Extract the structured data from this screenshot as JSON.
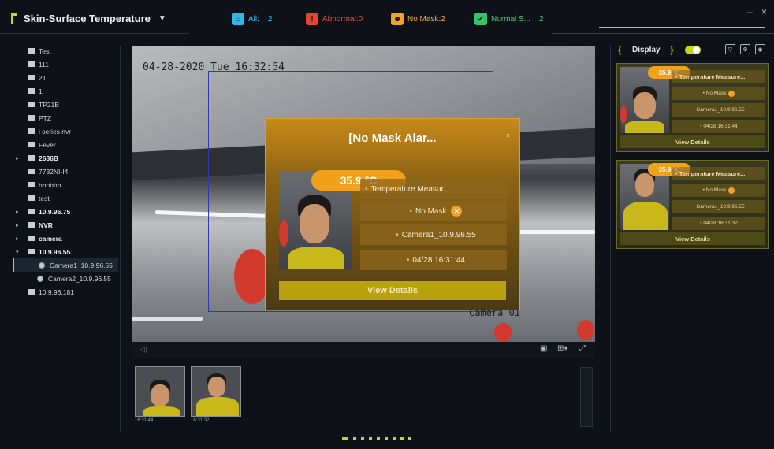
{
  "app": {
    "title": "Skin-Surface Temperature",
    "window_controls": {
      "minimize": "–",
      "close": "×"
    }
  },
  "stats": [
    {
      "label": "All:",
      "value": "2",
      "color": "#2fb8e6",
      "icon": "people-icon"
    },
    {
      "label": "Abnormal:0",
      "value": "",
      "color": "#e0462d",
      "icon": "thermometer-alert-icon"
    },
    {
      "label": "No Mask:2",
      "value": "",
      "color": "#f0a32b",
      "icon": "no-mask-face-icon"
    },
    {
      "label": "Normal S...",
      "value": "2",
      "color": "#35c46a",
      "icon": "thermometer-normal-icon"
    }
  ],
  "tree": [
    {
      "label": "Test",
      "bold": false,
      "arrow": "",
      "type": "folder"
    },
    {
      "label": "111",
      "bold": false,
      "arrow": "",
      "type": "folder"
    },
    {
      "label": "21",
      "bold": false,
      "arrow": "",
      "type": "folder"
    },
    {
      "label": "1",
      "bold": false,
      "arrow": "",
      "type": "folder"
    },
    {
      "label": "TP21B",
      "bold": false,
      "arrow": "",
      "type": "folder"
    },
    {
      "label": "PTZ",
      "bold": false,
      "arrow": "",
      "type": "folder"
    },
    {
      "label": "i series nvr",
      "bold": false,
      "arrow": "",
      "type": "folder"
    },
    {
      "label": "Fever",
      "bold": false,
      "arrow": "",
      "type": "folder"
    },
    {
      "label": "2636B",
      "bold": true,
      "arrow": "▸",
      "type": "folder"
    },
    {
      "label": "7732NI-I4",
      "bold": false,
      "arrow": "",
      "type": "folder"
    },
    {
      "label": "bbbbbb",
      "bold": false,
      "arrow": "",
      "type": "folder"
    },
    {
      "label": "test",
      "bold": false,
      "arrow": "",
      "type": "folder"
    },
    {
      "label": "10.9.96.75",
      "bold": true,
      "arrow": "▸",
      "type": "folder"
    },
    {
      "label": "NVR",
      "bold": true,
      "arrow": "▸",
      "type": "folder"
    },
    {
      "label": "camera",
      "bold": true,
      "arrow": "▸",
      "type": "folder"
    },
    {
      "label": "10.9.96.55",
      "bold": true,
      "arrow": "▾",
      "type": "folder"
    },
    {
      "label": "Camera1_10.9.96.55",
      "bold": false,
      "arrow": "",
      "type": "camera",
      "selected": true
    },
    {
      "label": "Camera2_10.9.96.55",
      "bold": false,
      "arrow": "",
      "type": "camera"
    },
    {
      "label": "10.9.96.181",
      "bold": false,
      "arrow": "",
      "type": "folder"
    }
  ],
  "video": {
    "timestamp": "04-28-2020 Tue 16:32:54",
    "camera_label": "Camera 01"
  },
  "alarm_popup": {
    "title": "[No Mask Alar...",
    "temperature": "35.9 °C",
    "rows": [
      "Temperature Measur...",
      "No Mask",
      "Camera1_10.9.96.55",
      "04/28 16:31:44"
    ],
    "view_details": "View Details"
  },
  "player_toolbar": {
    "volume_icon": "speaker-icon",
    "icons": [
      "window-icon",
      "layout-grid-icon",
      "fullscreen-icon"
    ]
  },
  "captures": [
    {
      "time": "16:31:44"
    },
    {
      "time": "16:31:32"
    }
  ],
  "more_button": "...",
  "right_panel": {
    "display_label": "Display",
    "cards": [
      {
        "temperature": "35.9 °C",
        "title": "Temperature Measure...",
        "mask": "No Mask",
        "camera": "Camera1_10.9.96.55",
        "time": "04/28 16:31:44",
        "view_details": "View Details"
      },
      {
        "temperature": "35.9 °C",
        "title": "Temperature Measure...",
        "mask": "No Mask",
        "camera": "Camera1_10.9.96.55",
        "time": "04/28 16:31:32",
        "view_details": "View Details"
      }
    ]
  },
  "colors": {
    "accent": "#c8d61a",
    "alarm": "#f2a11b",
    "background": "#0e1117"
  }
}
